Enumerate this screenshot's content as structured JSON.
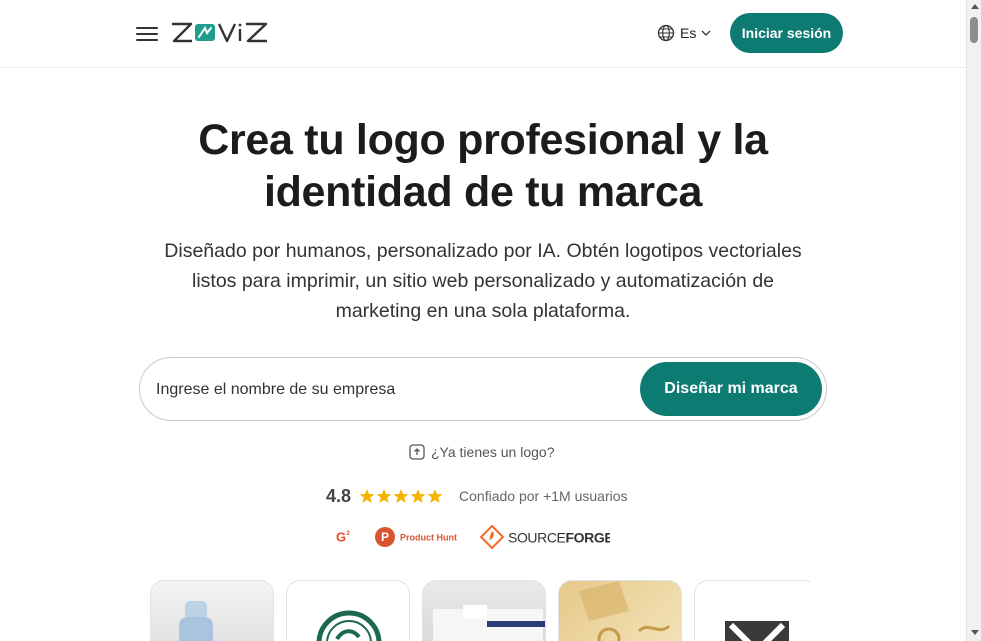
{
  "header": {
    "brand": "ZOVIZ",
    "language": "Es",
    "signin_label": "Iniciar sesión",
    "menu_icon": "hamburger-menu-icon"
  },
  "hero": {
    "title": "Crea tu logo profesional y la identidad de tu marca",
    "subtitle": "Diseñado por humanos, personalizado por IA. Obtén logotipos vectoriales listos para imprimir, un sitio web personalizado y automatización de marketing en una sola plataforma."
  },
  "search": {
    "placeholder": "Ingrese el nombre de su empresa",
    "value": "",
    "cta_label": "Diseñar mi marca"
  },
  "have_logo": {
    "label": "¿Ya tienes un logo?",
    "icon": "upload-icon"
  },
  "rating": {
    "score": "4.8",
    "stars": 5,
    "trust_text": "Confiado por +1M usuarios"
  },
  "badges": [
    {
      "name": "G2",
      "icon": "g2-logo"
    },
    {
      "name": "Product Hunt",
      "icon": "product-hunt-logo"
    },
    {
      "name": "SOURCEFORGE",
      "icon": "sourceforge-logo"
    }
  ],
  "colors": {
    "accent": "#0e7b73",
    "star": "#f5b301",
    "text": "#1c1c1c"
  },
  "cards": [
    {
      "name": "bottle-mockup"
    },
    {
      "name": "green-emblem-mockup"
    },
    {
      "name": "stationery-mockup"
    },
    {
      "name": "gold-pattern-mockup"
    },
    {
      "name": "m-monogram-mockup"
    }
  ]
}
